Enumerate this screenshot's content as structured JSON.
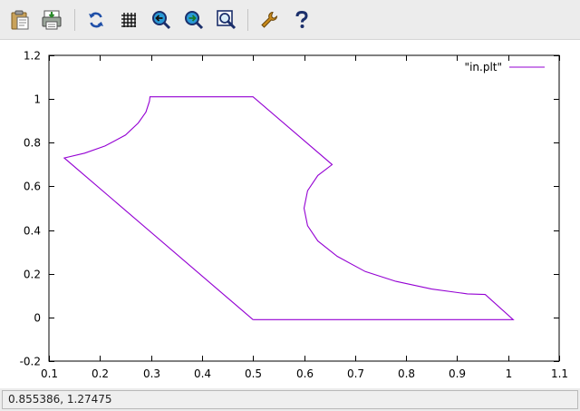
{
  "toolbar": {
    "buttons": [
      {
        "name": "copy-to-clipboard-button",
        "icon": "clipboard-icon"
      },
      {
        "name": "print-button",
        "icon": "printer-icon"
      },
      {
        "name": "replot-button",
        "icon": "refresh-icon"
      },
      {
        "name": "toggle-grid-button",
        "icon": "grid-icon"
      },
      {
        "name": "previous-zoom-button",
        "icon": "zoom-previous-icon"
      },
      {
        "name": "next-zoom-button",
        "icon": "zoom-next-icon"
      },
      {
        "name": "autoscale-button",
        "icon": "zoom-fit-icon"
      },
      {
        "name": "options-button",
        "icon": "wrench-icon"
      },
      {
        "name": "help-button",
        "icon": "help-icon"
      }
    ]
  },
  "chart_data": {
    "type": "line",
    "title": "",
    "xlabel": "",
    "ylabel": "",
    "xlim": [
      0.1,
      1.1
    ],
    "ylim": [
      -0.2,
      1.2
    ],
    "x_ticks": [
      "0.1",
      "0.2",
      "0.3",
      "0.4",
      "0.5",
      "0.6",
      "0.7",
      "0.8",
      "0.9",
      "1",
      "1.1"
    ],
    "y_ticks": [
      "-0.2",
      "0",
      "0.2",
      "0.4",
      "0.6",
      "0.8",
      "1",
      "1.2"
    ],
    "grid": false,
    "legend_position": "top-right",
    "series": [
      {
        "name": "\"in.plt\"",
        "color": "#9400d3",
        "points": [
          [
            0.5,
            -0.01
          ],
          [
            1.01,
            -0.01
          ],
          [
            0.955,
            0.105
          ],
          [
            0.92,
            0.108
          ],
          [
            0.85,
            0.13
          ],
          [
            0.78,
            0.165
          ],
          [
            0.72,
            0.21
          ],
          [
            0.665,
            0.28
          ],
          [
            0.627,
            0.35
          ],
          [
            0.607,
            0.42
          ],
          [
            0.6,
            0.5
          ],
          [
            0.607,
            0.58
          ],
          [
            0.627,
            0.65
          ],
          [
            0.655,
            0.7
          ],
          [
            0.5,
            1.01
          ],
          [
            0.298,
            1.01
          ],
          [
            0.297,
            0.99
          ],
          [
            0.29,
            0.94
          ],
          [
            0.275,
            0.89
          ],
          [
            0.25,
            0.835
          ],
          [
            0.21,
            0.785
          ],
          [
            0.17,
            0.752
          ],
          [
            0.13,
            0.73
          ],
          [
            0.5,
            -0.01
          ]
        ]
      }
    ]
  },
  "status": {
    "coordinates": "0.855386,  1.27475"
  }
}
